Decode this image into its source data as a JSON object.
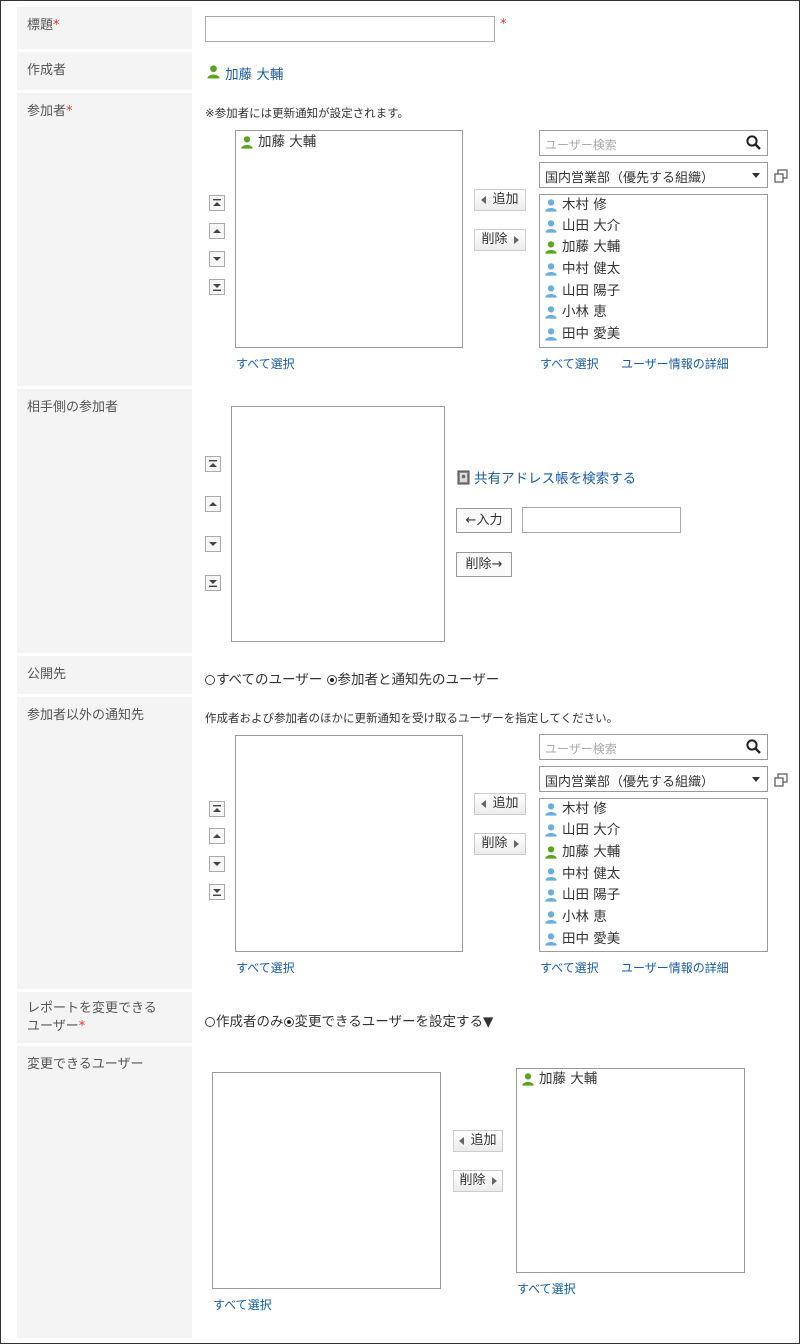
{
  "fields": {
    "title": "標題",
    "creator": "作成者",
    "participants": "参加者",
    "counterpart": "相手側の参加者",
    "visibility": "公開先",
    "notify_others": "参加者以外の通知先",
    "editable_line1": "レポートを変更できる",
    "editable_line2": "ユーザー",
    "changeable_users": "変更できるユーザー"
  },
  "required_mark": "*",
  "creator_name": "加藤 大輔",
  "participants_note": "※参加者には更新通知が設定されます。",
  "notify_note": "作成者および参加者のほかに更新通知を受け取るユーザーを指定してください。",
  "selected_participants": [
    "加藤 大輔"
  ],
  "search_placeholder": "ユーザー検索",
  "org_select": "国内営業部（優先する組織）",
  "candidate_users": [
    "木村 修",
    "山田 大介",
    "加藤 大輔",
    "中村 健太",
    "山田 陽子",
    "小林 恵",
    "田中 愛美"
  ],
  "add_label": "追加",
  "remove_label": "削除",
  "select_all": "すべて選択",
  "user_detail": "ユーザー情報の詳細",
  "address_book_link": "共有アドレス帳を検索する",
  "input_btn": "←入力",
  "remove_arrow_btn": "削除→",
  "visibility_opt1": "すべてのユーザー",
  "visibility_opt2": "参加者と通知先のユーザー",
  "editable_opt1": "作成者のみ",
  "editable_opt2": "変更できるユーザーを設定する▼",
  "changeable_selected": [
    "加藤 大輔"
  ],
  "colors": {
    "link": "#1a5da0",
    "required": "#e03030",
    "user_blue": "#6aaee0",
    "user_green": "#5aa51e"
  }
}
